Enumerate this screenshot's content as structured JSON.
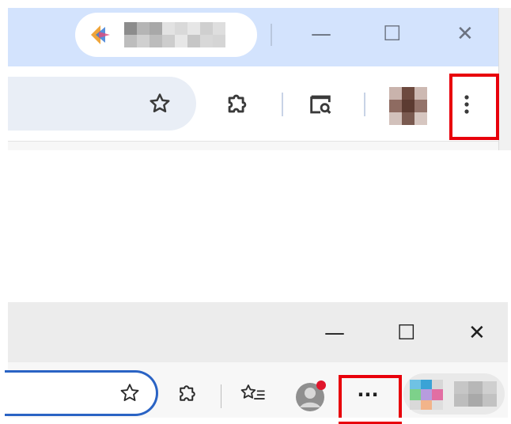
{
  "chrome": {
    "window_controls": {
      "minimize_glyph": "—",
      "maximize_glyph": "☐",
      "close_glyph": "✕"
    },
    "toolbar": {
      "bookmark_star_icon": "star-outline-icon",
      "extensions_icon": "puzzle-piece-icon",
      "reading_mode_icon": "reader-search-icon",
      "profile_avatar": "avatar",
      "menu_icon": "three-vertical-dots-icon"
    },
    "highlight_color": "#e8000b",
    "accent_titlebar": "#d3e3fd"
  },
  "edge": {
    "window_controls": {
      "minimize_glyph": "—",
      "maximize_glyph": "☐",
      "close_glyph": "✕"
    },
    "toolbar": {
      "favorite_star_icon": "star-outline-icon",
      "extensions_icon": "puzzle-piece-icon",
      "favorites_icon": "favorites-list-icon",
      "profile_avatar": "avatar-with-notification",
      "menu_glyph": "···"
    },
    "address_bar_border": "#2a63c4",
    "highlight_color": "#e8000b"
  }
}
